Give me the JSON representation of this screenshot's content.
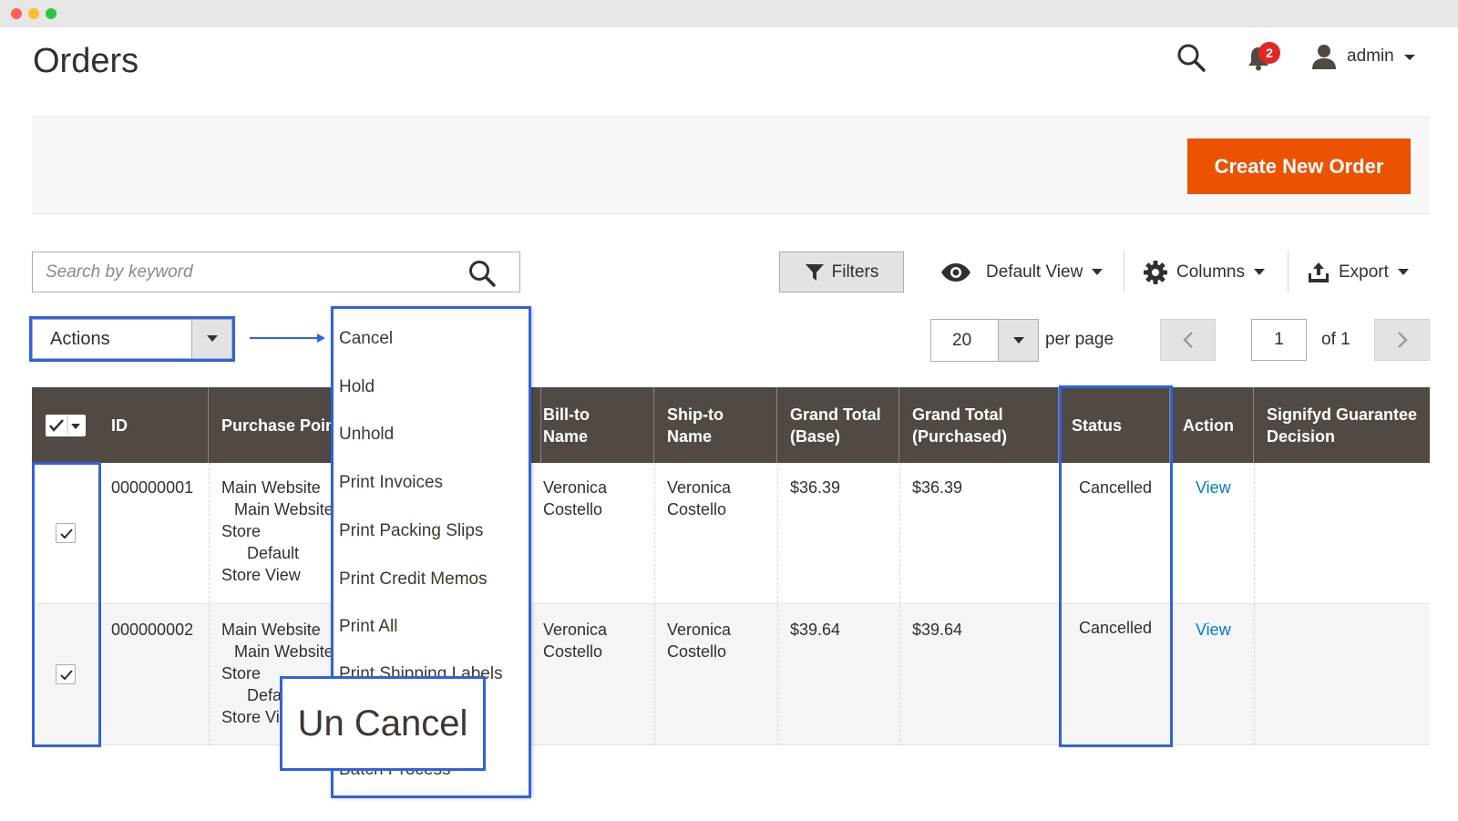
{
  "header": {
    "title": "Orders",
    "notification_count": "2",
    "user_name": "admin"
  },
  "actionbar": {
    "create_label": "Create New Order"
  },
  "toolbar": {
    "search_placeholder": "Search by keyword",
    "filters_label": "Filters",
    "view_label": "Default View",
    "columns_label": "Columns",
    "export_label": "Export",
    "actions_label": "Actions",
    "per_page_value": "20",
    "per_page_label": "per page",
    "page_current": "1",
    "page_total": "of 1"
  },
  "actions_menu": {
    "items": [
      "Cancel",
      "Hold",
      "Unhold",
      "Print Invoices",
      "Print Packing Slips",
      "Print Credit Memos",
      "Print All",
      "Print Shipping Labels",
      "Un Cancel",
      "Batch Process"
    ],
    "highlighted": "Un Cancel"
  },
  "grid": {
    "columns": [
      "ID",
      "Purchase Point",
      "Bill-to Name",
      "Ship-to Name",
      "Grand Total (Base)",
      "Grand Total (Purchased)",
      "Status",
      "Action",
      "Signifyd Guarantee Decision"
    ],
    "column_lines": {
      "bill_to": [
        "Bill-to",
        "Name"
      ],
      "ship_to": [
        "Ship-to",
        "Name"
      ],
      "gt_base": [
        "Grand Total",
        "(Base)"
      ],
      "gt_purchased": [
        "Grand Total",
        "(Purchased)"
      ],
      "signifyd": [
        "Signifyd Guarantee",
        "Decision"
      ]
    },
    "rows": [
      {
        "id": "000000001",
        "purchase_point": [
          "Main Website",
          "Main Website",
          "Store",
          "Default",
          "Store View"
        ],
        "bill_to": [
          "Veronica",
          "Costello"
        ],
        "ship_to": [
          "Veronica",
          "Costello"
        ],
        "grand_total_base": "$36.39",
        "grand_total_purchased": "$36.39",
        "status": "Cancelled",
        "action": "View"
      },
      {
        "id": "000000002",
        "purchase_point": [
          "Main Website",
          "Main Website",
          "Store",
          "Default",
          "Store View"
        ],
        "bill_to": [
          "Veronica",
          "Costello"
        ],
        "ship_to": [
          "Veronica",
          "Costello"
        ],
        "grand_total_base": "$39.64",
        "grand_total_purchased": "$39.64",
        "status": "Cancelled",
        "action": "View"
      }
    ]
  },
  "colors": {
    "accent": "#eb5202",
    "grid_header": "#514943",
    "highlight": "#2f62e0",
    "link": "#007bdb"
  },
  "icons": [
    "search-icon",
    "bell-icon",
    "user-icon",
    "filter-icon",
    "eye-icon",
    "gear-icon",
    "upload-icon",
    "chevron-left-icon",
    "chevron-right-icon",
    "checkmark-icon"
  ]
}
